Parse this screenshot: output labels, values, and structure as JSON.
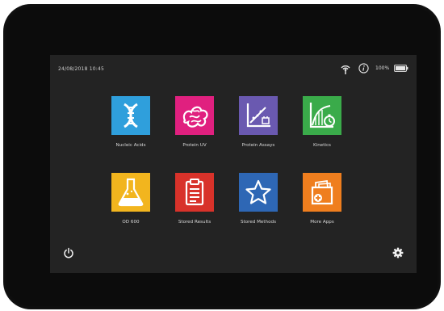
{
  "status_bar": {
    "datetime": "24/08/2018 10:45",
    "battery_percent": "100%",
    "icons": [
      "wifi-icon",
      "info-icon",
      "battery-icon"
    ]
  },
  "apps": [
    {
      "label": "Nucleic Acids",
      "icon": "dna-icon",
      "color": "#2f9fdc"
    },
    {
      "label": "Protein UV",
      "icon": "protein-icon",
      "color": "#e0207f"
    },
    {
      "label": "Protein Assays",
      "icon": "assay-chart-icon",
      "color": "#6a59b0"
    },
    {
      "label": "Kinetics",
      "icon": "kinetics-chart-icon",
      "color": "#3aab4a"
    },
    {
      "label": "OD 600",
      "icon": "flask-icon",
      "color": "#f2b51e"
    },
    {
      "label": "Stored Results",
      "icon": "clipboard-icon",
      "color": "#d8322a"
    },
    {
      "label": "Stored Methods",
      "icon": "star-icon",
      "color": "#2e67b5"
    },
    {
      "label": "More Apps",
      "icon": "folder-add-icon",
      "color": "#ef7e1e"
    }
  ],
  "bottom_bar": {
    "icons": [
      "power-icon",
      "settings-gear-icon"
    ]
  }
}
